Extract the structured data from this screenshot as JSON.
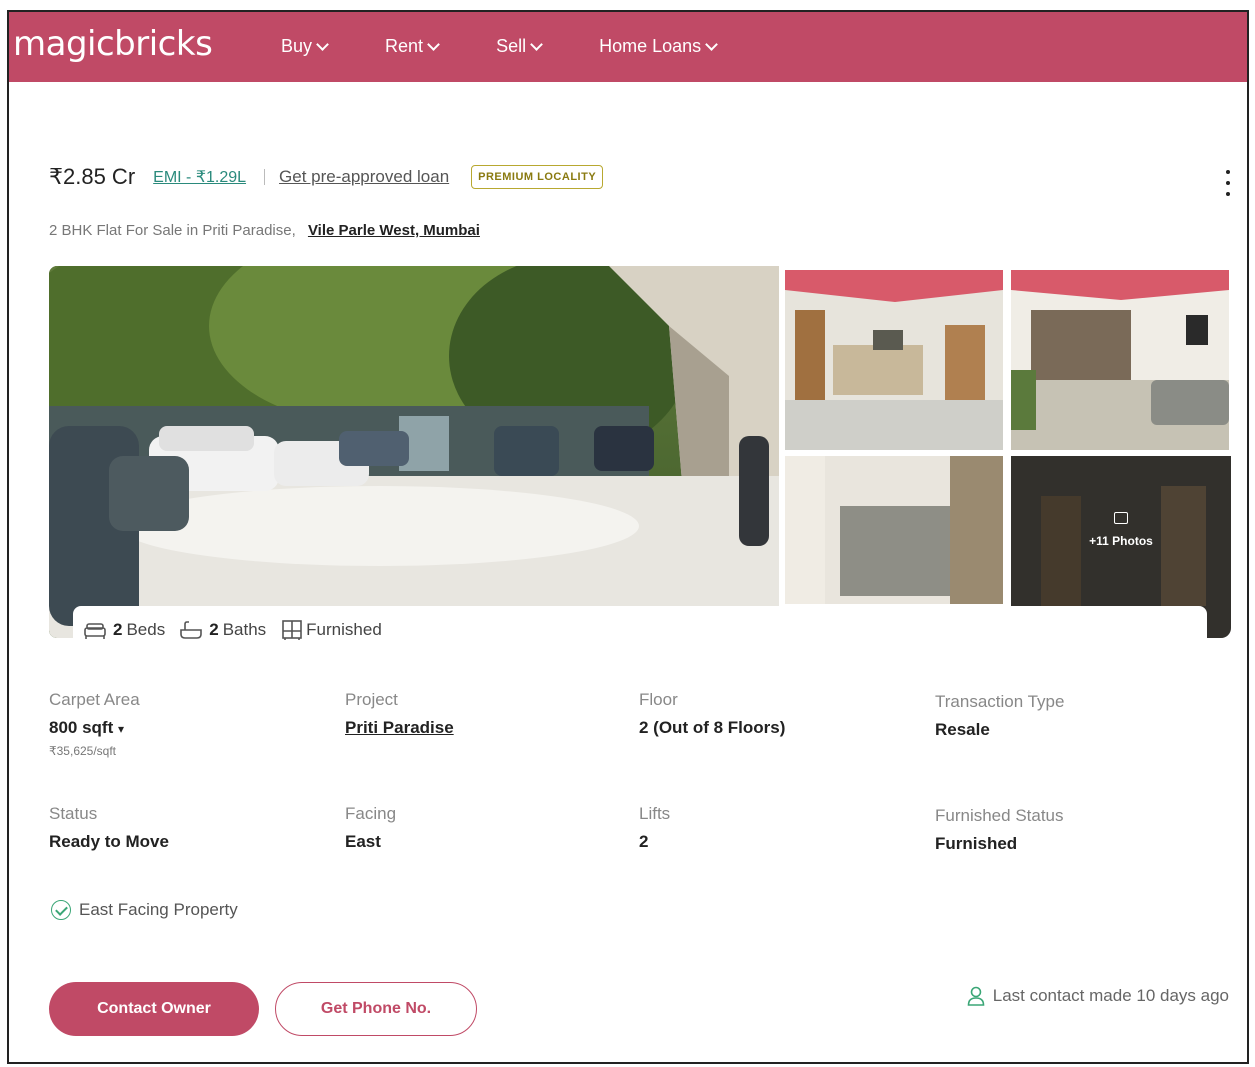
{
  "header": {
    "logo": "magicbricks",
    "nav": [
      {
        "label": "Buy"
      },
      {
        "label": "Rent"
      },
      {
        "label": "Sell"
      },
      {
        "label": "Home Loans"
      }
    ],
    "brand_color": "#c04a66"
  },
  "listing": {
    "price": "₹2.85 Cr",
    "emi": "EMI - ₹1.29L",
    "loan_link": "Get pre-approved loan",
    "badge": "PREMIUM LOCALITY",
    "subtitle": "2 BHK Flat For Sale in Priti Paradise,",
    "location": "Vile Parle West, Mumbai"
  },
  "gallery": {
    "photos_label": "+11 Photos"
  },
  "features": {
    "beds_count": "2",
    "beds_label": "Beds",
    "baths_count": "2",
    "baths_label": "Baths",
    "furnishing": "Furnished"
  },
  "details": {
    "carpet_area": {
      "label": "Carpet Area",
      "value": "800 sqft",
      "sub": "₹35,625/sqft"
    },
    "project": {
      "label": "Project",
      "value": "Priti Paradise"
    },
    "floor": {
      "label": "Floor",
      "value": "2 (Out of 8 Floors)"
    },
    "transaction": {
      "label": "Transaction Type",
      "value": "Resale"
    },
    "status": {
      "label": "Status",
      "value": "Ready to Move"
    },
    "facing": {
      "label": "Facing",
      "value": "East"
    },
    "lifts": {
      "label": "Lifts",
      "value": "2"
    },
    "furnished_status": {
      "label": "Furnished Status",
      "value": "Furnished"
    }
  },
  "highlight": "East Facing Property",
  "actions": {
    "contact_owner": "Contact Owner",
    "get_phone": "Get Phone No.",
    "last_contact": "Last contact made 10 days ago"
  }
}
